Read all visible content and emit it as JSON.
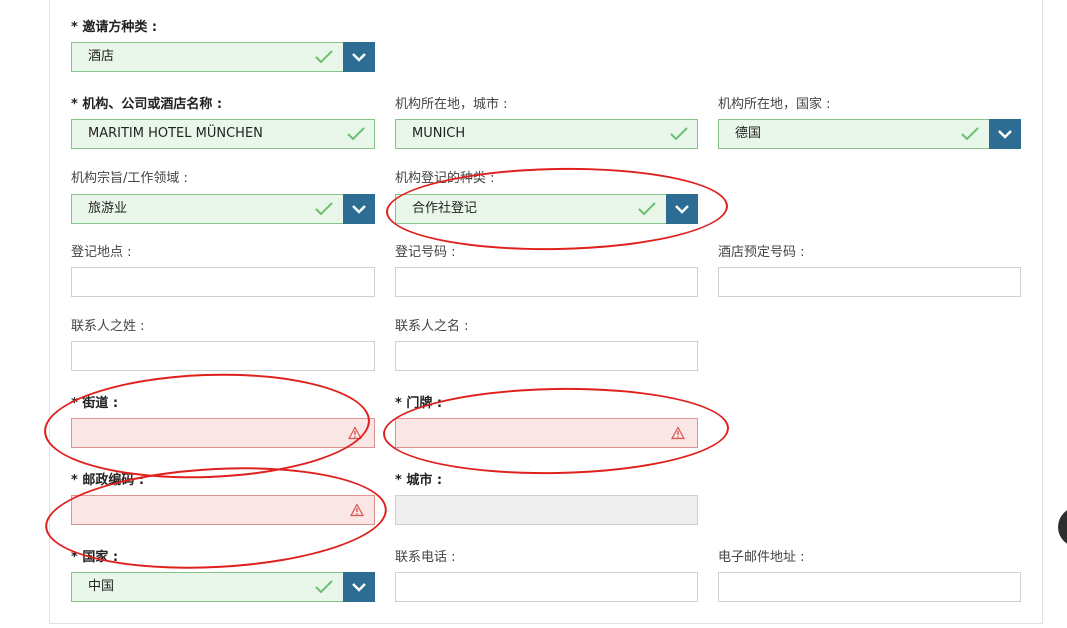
{
  "form": {
    "inviter_type": {
      "label": "* 邀请方种类 :",
      "value": "酒店"
    },
    "org_name": {
      "label": "* 机构、公司或酒店名称 :",
      "value": "MARITIM HOTEL MÜNCHEN"
    },
    "org_city": {
      "label": "机构所在地，城市 :",
      "value": "MUNICH"
    },
    "org_country": {
      "label": "机构所在地，国家 :",
      "value": "德国"
    },
    "org_purpose": {
      "label": "机构宗旨/工作领域 :",
      "value": "旅游业"
    },
    "registration_type": {
      "label": "机构登记的种类 :",
      "value": "合作社登记"
    },
    "registration_place": {
      "label": "登记地点 :",
      "value": ""
    },
    "registration_number": {
      "label": "登记号码 :",
      "value": ""
    },
    "hotel_booking_number": {
      "label": "酒店预定号码 :",
      "value": ""
    },
    "contact_surname": {
      "label": "联系人之姓 :",
      "value": ""
    },
    "contact_given_name": {
      "label": "联系人之名 :",
      "value": ""
    },
    "street": {
      "label": "* 街道 :",
      "value": ""
    },
    "house_number": {
      "label": "* 门牌 :",
      "value": ""
    },
    "postal_code": {
      "label": "* 邮政编码 :",
      "value": ""
    },
    "city": {
      "label": "* 城市 :",
      "value": ""
    },
    "country": {
      "label": "* 国家 :",
      "value": "中国"
    },
    "phone": {
      "label": "联系电话 :",
      "value": ""
    },
    "email": {
      "label": "电子邮件地址 :",
      "value": ""
    }
  },
  "colors": {
    "valid_bg": "#e9f7ea",
    "valid_border": "#88c48a",
    "check": "#6cc070",
    "error_bg": "#fbe6e6",
    "error_border": "#e09393",
    "warn": "#d9534f",
    "dropdown_btn": "#2d6c93",
    "annotation_ring": "#e0201c"
  },
  "icons": {
    "valid": "check-icon",
    "error": "warning-triangle-icon",
    "dropdown": "chevron-down-icon"
  }
}
